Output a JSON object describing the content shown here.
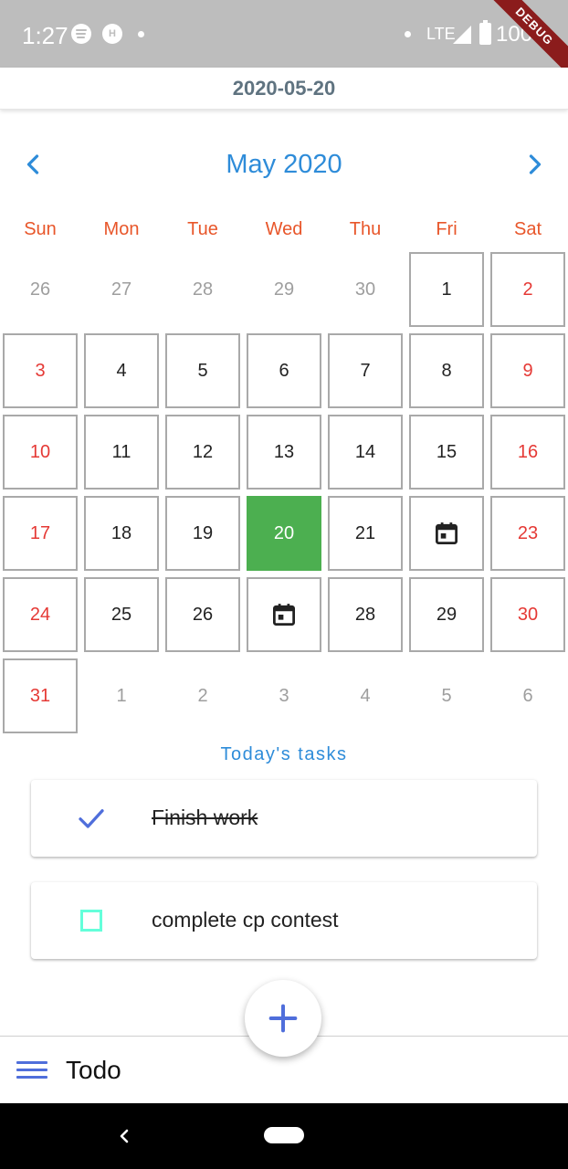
{
  "status_bar": {
    "time": "1:27",
    "network": "LTE",
    "battery": "100%",
    "ribbon": "DEBUG",
    "icons": [
      "spotify-icon",
      "app-notification-icon",
      "signal-icon",
      "battery-icon"
    ]
  },
  "app_bar": {
    "title": "2020-05-20"
  },
  "calendar": {
    "month_title": "May 2020",
    "prev_icon": "chevron-left-icon",
    "next_icon": "chevron-right-icon",
    "weekdays": [
      "Sun",
      "Mon",
      "Tue",
      "Wed",
      "Thu",
      "Fri",
      "Sat"
    ],
    "selected_day": "20",
    "event_icon": "calendar-event-icon",
    "days": [
      {
        "label": "26",
        "type": "out"
      },
      {
        "label": "27",
        "type": "out"
      },
      {
        "label": "28",
        "type": "out"
      },
      {
        "label": "29",
        "type": "out"
      },
      {
        "label": "30",
        "type": "out"
      },
      {
        "label": "1",
        "type": "day"
      },
      {
        "label": "2",
        "type": "weekend"
      },
      {
        "label": "3",
        "type": "weekend"
      },
      {
        "label": "4",
        "type": "day"
      },
      {
        "label": "5",
        "type": "day"
      },
      {
        "label": "6",
        "type": "day"
      },
      {
        "label": "7",
        "type": "day"
      },
      {
        "label": "8",
        "type": "day"
      },
      {
        "label": "9",
        "type": "weekend"
      },
      {
        "label": "10",
        "type": "weekend"
      },
      {
        "label": "11",
        "type": "day"
      },
      {
        "label": "12",
        "type": "day"
      },
      {
        "label": "13",
        "type": "day"
      },
      {
        "label": "14",
        "type": "day"
      },
      {
        "label": "15",
        "type": "day"
      },
      {
        "label": "16",
        "type": "weekend"
      },
      {
        "label": "17",
        "type": "weekend"
      },
      {
        "label": "18",
        "type": "day"
      },
      {
        "label": "19",
        "type": "day"
      },
      {
        "label": "20",
        "type": "selected"
      },
      {
        "label": "21",
        "type": "day"
      },
      {
        "label": "",
        "type": "event"
      },
      {
        "label": "23",
        "type": "weekend"
      },
      {
        "label": "24",
        "type": "weekend"
      },
      {
        "label": "25",
        "type": "day"
      },
      {
        "label": "26",
        "type": "day"
      },
      {
        "label": "",
        "type": "event"
      },
      {
        "label": "28",
        "type": "day"
      },
      {
        "label": "29",
        "type": "day"
      },
      {
        "label": "30",
        "type": "weekend"
      },
      {
        "label": "31",
        "type": "weekend"
      },
      {
        "label": "1",
        "type": "out"
      },
      {
        "label": "2",
        "type": "out"
      },
      {
        "label": "3",
        "type": "out"
      },
      {
        "label": "4",
        "type": "out"
      },
      {
        "label": "5",
        "type": "out"
      },
      {
        "label": "6",
        "type": "out"
      }
    ]
  },
  "tasks": {
    "heading": "Today's tasks",
    "items": [
      {
        "title": "Finish work",
        "done": true
      },
      {
        "title": "complete cp contest",
        "done": false
      }
    ]
  },
  "fab": {
    "icon": "plus-icon"
  },
  "bottom_bar": {
    "menu_icon": "menu-icon",
    "title": "Todo"
  },
  "colors": {
    "accent_blue": "#2e8cd9",
    "weekday_orange": "#e8562a",
    "weekend_red": "#e53935",
    "selected_green": "#4caf50",
    "icon_indigo": "#4f6edb",
    "checkbox_teal": "#64ffda"
  }
}
